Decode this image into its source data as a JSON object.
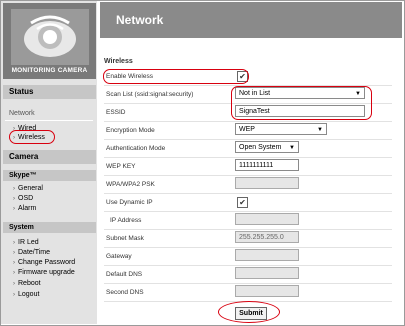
{
  "logo": {
    "text": "MONITORING CAMERA"
  },
  "sidebar": {
    "status": "Status",
    "network": "Network",
    "network_items": [
      "Wired",
      "Wireless"
    ],
    "camera": "Camera",
    "skype": "Skype™",
    "skype_items": [
      "General",
      "OSD",
      "Alarm"
    ],
    "system": "System",
    "system_items": [
      "IR Led",
      "Date/Time",
      "Change Password",
      "Firmware upgrade",
      "Reboot",
      "Logout"
    ]
  },
  "header": {
    "title": "Network"
  },
  "section": {
    "title": "Wireless"
  },
  "form": {
    "enable_wireless": "Enable Wireless",
    "scan_list": "Scan List (ssid:signal:security)",
    "scan_value": "Not in List",
    "essid": "ESSID",
    "essid_value": "SignaTest",
    "encryption": "Encryption Mode",
    "encryption_value": "WEP",
    "auth": "Authentication Mode",
    "auth_value": "Open System",
    "wep_key": "WEP KEY",
    "wep_value": "1111111111",
    "wpa_psk": "WPA/WPA2 PSK",
    "dynamic_ip": "Use Dynamic IP",
    "ip_address": "IP Address",
    "subnet": "Subnet Mask",
    "subnet_value": "255.255.255.0",
    "gateway": "Gateway",
    "dns1": "Default DNS",
    "dns2": "Second DNS"
  },
  "submit_label": "Submit",
  "colors": {
    "highlight": "#d8000f",
    "header_bg": "#8a8a8a",
    "sidebar_bg": "#e3e3e3"
  }
}
